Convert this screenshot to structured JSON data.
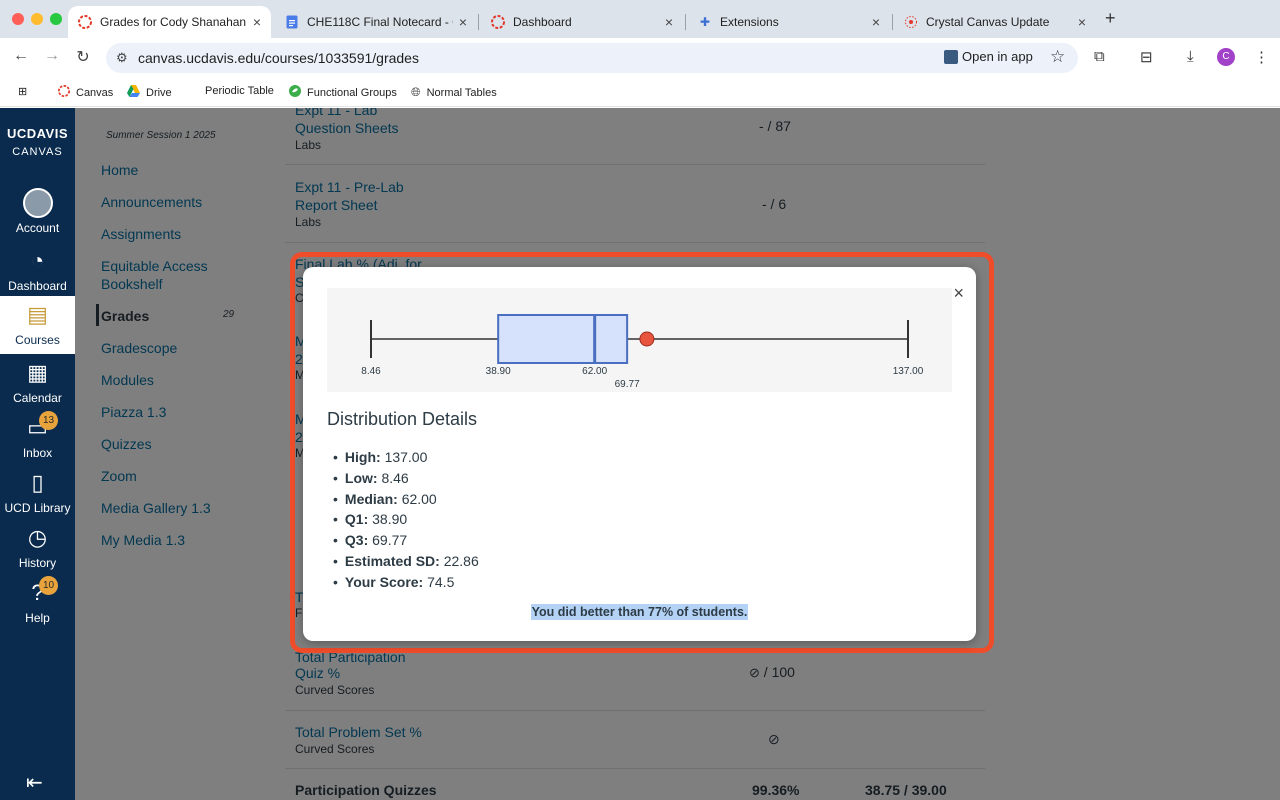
{
  "browser": {
    "tabs": [
      {
        "label": "Grades for Cody Shanahan: C",
        "icon": "canvas-icon"
      },
      {
        "label": "CHE118C Final Notecard - Go",
        "icon": "docs-icon"
      },
      {
        "label": "Dashboard",
        "icon": "canvas-icon"
      },
      {
        "label": "Extensions",
        "icon": "puzzle-icon"
      },
      {
        "label": "Crystal Canvas Update",
        "icon": "crystal-icon"
      }
    ],
    "url": "canvas.ucdavis.edu/courses/1033591/grades",
    "open_in_app": "Open in app",
    "profile_initial": "C",
    "bookmarks": [
      {
        "label": "Canvas"
      },
      {
        "label": "Drive"
      },
      {
        "label": "Periodic Table"
      },
      {
        "label": "Functional Groups"
      },
      {
        "label": "Normal Tables"
      }
    ]
  },
  "global_nav": {
    "brand_line1": "UCDAVIS",
    "brand_line2": "CANVAS",
    "items": [
      {
        "label": "Account",
        "icon": "account-icon"
      },
      {
        "label": "Dashboard",
        "icon": "dashboard-icon"
      },
      {
        "label": "Courses",
        "icon": "courses-icon"
      },
      {
        "label": "Calendar",
        "icon": "calendar-icon"
      },
      {
        "label": "Inbox",
        "icon": "inbox-icon",
        "badge": "13"
      },
      {
        "label": "UCD Library",
        "icon": "library-icon"
      },
      {
        "label": "History",
        "icon": "history-icon"
      },
      {
        "label": "Help",
        "icon": "help-icon",
        "badge": "10"
      }
    ]
  },
  "course_nav": {
    "term": "Summer Session 1 2025",
    "items": [
      {
        "label": "Home"
      },
      {
        "label": "Announcements"
      },
      {
        "label": "Assignments"
      },
      {
        "label": "Equitable Access Bookshelf"
      },
      {
        "label": "Grades",
        "count": "29"
      },
      {
        "label": "Gradescope"
      },
      {
        "label": "Modules"
      },
      {
        "label": "Piazza 1.3"
      },
      {
        "label": "Quizzes"
      },
      {
        "label": "Zoom"
      },
      {
        "label": "Media Gallery 1.3"
      },
      {
        "label": "My Media 1.3"
      }
    ]
  },
  "grades": {
    "rows": [
      {
        "title1": "Expt 11 - Lab",
        "title2": "Question Sheets",
        "category": "Labs",
        "score": "- / 87"
      },
      {
        "title1": "Expt 11 - Pre-Lab",
        "title2": "Report Sheet",
        "category": "Labs",
        "score": "- / 6"
      },
      {
        "title1": "Final Lab % (Adj. for",
        "title2": "S"
      },
      {
        "title1": "Total Participation",
        "title2": "Quiz %",
        "category": "Curved Scores",
        "score": "/ 100"
      },
      {
        "title1": "Total Problem Set %",
        "category": "Curved Scores"
      }
    ],
    "partial_letters": [
      "C",
      "M",
      "2",
      "M",
      "M",
      "2",
      "M",
      "T",
      "F"
    ],
    "summary": {
      "label": "Participation Quizzes",
      "percent": "99.36%",
      "points": "38.75 / 39.00"
    }
  },
  "dialog": {
    "close_label": "×",
    "title": "Distribution Details",
    "stats": [
      {
        "label": "High:",
        "value": "137.00"
      },
      {
        "label": "Low:",
        "value": "8.46"
      },
      {
        "label": "Median:",
        "value": "62.00"
      },
      {
        "label": "Q1:",
        "value": "38.90"
      },
      {
        "label": "Q3:",
        "value": "69.77"
      },
      {
        "label": "Estimated SD:",
        "value": "22.86"
      },
      {
        "label": "Your Score:",
        "value": "74.5"
      }
    ],
    "comparison": "You did better than 77% of students."
  },
  "chart_data": {
    "type": "boxplot",
    "min": 8.46,
    "q1": 38.9,
    "median": 62.0,
    "q3": 69.77,
    "max": 137.0,
    "your_score": 74.5,
    "tick_labels": [
      "8.46",
      "38.90",
      "62.00",
      "69.77",
      "137.00"
    ],
    "colors": {
      "box_fill": "#d6e2fb",
      "box_stroke": "#4a6fc0",
      "whisker": "#333333",
      "score_marker": "#e8553f",
      "panel": "#f5f5f5"
    }
  }
}
